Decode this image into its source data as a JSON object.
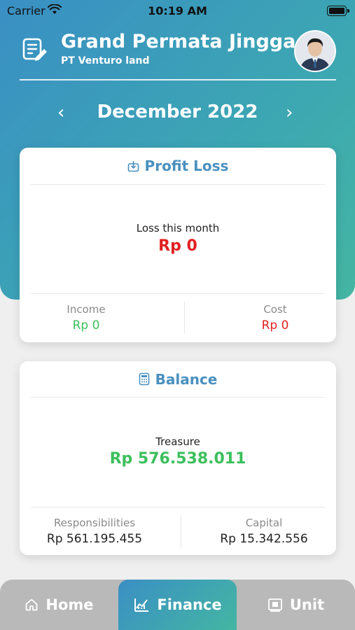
{
  "status_bar": {
    "carrier": "Carrier",
    "time": "10:19 AM"
  },
  "header": {
    "project_name": "Grand Permata Jingga",
    "company": "PT Venturo land",
    "avatar_icon": "user-avatar"
  },
  "month_selector": {
    "label": "December 2022",
    "prev": "‹",
    "next": "›"
  },
  "profit_loss": {
    "title": "Profit Loss",
    "main_label": "Loss this month",
    "main_value": "Rp 0",
    "income_label": "Income",
    "income_value": "Rp 0",
    "cost_label": "Cost",
    "cost_value": "Rp 0"
  },
  "balance": {
    "title": "Balance",
    "main_label": "Treasure",
    "main_value": "Rp 576.538.011",
    "responsibilities_label": "Responsibilities",
    "responsibilities_value": "Rp 561.195.455",
    "capital_label": "Capital",
    "capital_value": "Rp 15.342.556"
  },
  "bottom_nav": {
    "home": "Home",
    "finance": "Finance",
    "unit": "Unit",
    "active": "Finance"
  },
  "colors": {
    "accent_start": "#3a8fc4",
    "accent_end": "#44b6a2",
    "title_blue": "#4a90bf",
    "loss_red": "#e02020",
    "income_green": "#3cbf5c"
  }
}
